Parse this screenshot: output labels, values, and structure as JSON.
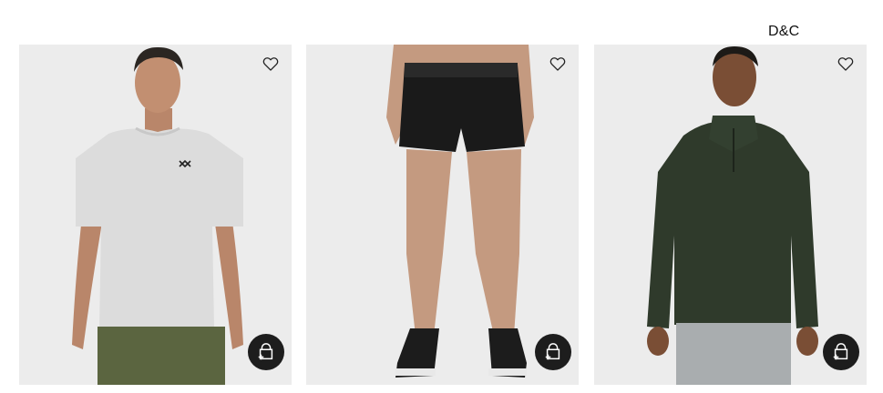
{
  "header": {
    "brand_text": "D&C"
  },
  "products": [
    {
      "image": "man-white-tshirt-olive-shorts",
      "wishlist_icon": "heart-outline-icon",
      "quick_add_icon": "bag-plus-icon",
      "colors": {
        "shirt": "#dcdcdc",
        "shorts": "#5b6540"
      }
    },
    {
      "image": "woman-black-shorts-sneakers",
      "wishlist_icon": "heart-outline-icon",
      "quick_add_icon": "bag-plus-icon",
      "colors": {
        "shorts": "#1a1a1a",
        "shoes": "#1c1c1c"
      }
    },
    {
      "image": "man-green-quarter-zip-grey-pants",
      "wishlist_icon": "heart-outline-icon",
      "quick_add_icon": "bag-plus-icon",
      "colors": {
        "top": "#2f3a2b",
        "pants": "#a9adaf"
      }
    }
  ],
  "colors": {
    "card_background": "#ececec",
    "quick_add_background": "#1d1d1d"
  }
}
